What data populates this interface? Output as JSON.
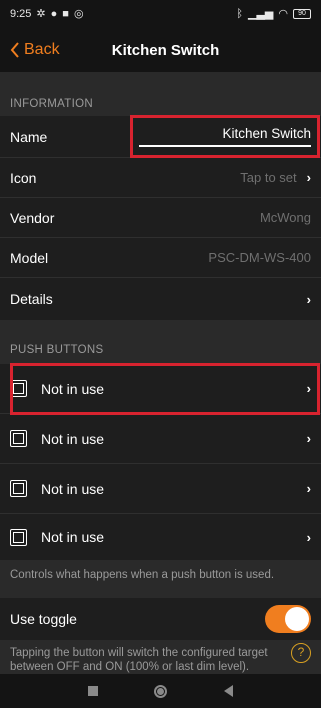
{
  "status_bar": {
    "time": "9:25",
    "icons_left": [
      "fan-icon",
      "facebook-icon",
      "square-icon",
      "camera-icon"
    ],
    "icons_right": [
      "bluetooth-icon",
      "signal-icon",
      "wifi-icon",
      "battery-icon"
    ],
    "battery": "90"
  },
  "navbar": {
    "back_label": "Back",
    "title": "Kitchen Switch"
  },
  "information": {
    "header": "INFORMATION",
    "rows": {
      "name": {
        "label": "Name",
        "value": "Kitchen Switch"
      },
      "icon": {
        "label": "Icon",
        "value": "Tap to set"
      },
      "vendor": {
        "label": "Vendor",
        "value": "McWong"
      },
      "model": {
        "label": "Model",
        "value": "PSC-DM-WS-400"
      },
      "details": {
        "label": "Details"
      }
    }
  },
  "push_buttons": {
    "header": "PUSH BUTTONS",
    "items": [
      {
        "label": "Not in use"
      },
      {
        "label": "Not in use"
      },
      {
        "label": "Not in use"
      },
      {
        "label": "Not in use"
      }
    ],
    "note": "Controls what happens when a push button is used."
  },
  "use_toggle": {
    "label": "Use toggle",
    "enabled": true,
    "description": "Tapping the button will switch the configured target between OFF and ON (100% or last dim level)."
  },
  "colors": {
    "accent": "#f07e1f",
    "highlight": "#d8232f",
    "background": "#2a2a2a",
    "row": "#1e1e1e"
  },
  "icons": {
    "chevron": "›",
    "help": "?"
  }
}
